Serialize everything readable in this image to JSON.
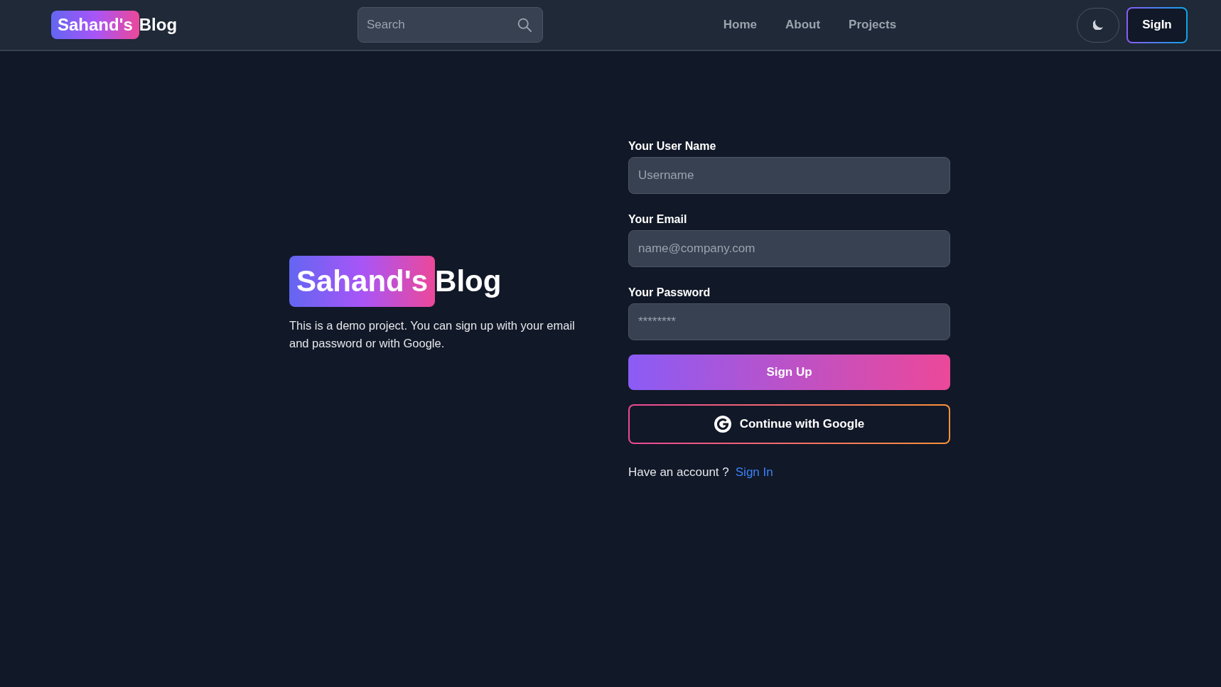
{
  "header": {
    "logo": {
      "badge": "Sahand's",
      "text": "Blog"
    },
    "search": {
      "placeholder": "Search"
    },
    "nav": [
      {
        "label": "Home"
      },
      {
        "label": "About"
      },
      {
        "label": "Projects"
      }
    ],
    "signin_button": "SigIn"
  },
  "intro": {
    "logo": {
      "badge": "Sahand's",
      "text": "Blog"
    },
    "description": "This is a demo project. You can sign up with your email and password or with Google."
  },
  "form": {
    "fields": [
      {
        "label": "Your User Name",
        "placeholder": "Username"
      },
      {
        "label": "Your Email",
        "placeholder": "name@company.com"
      },
      {
        "label": "Your Password",
        "placeholder": "********"
      }
    ],
    "submit_button": "Sign Up",
    "google_button": "Continue with Google",
    "footer": {
      "text": "Have an account ?",
      "link": "Sign In"
    }
  }
}
